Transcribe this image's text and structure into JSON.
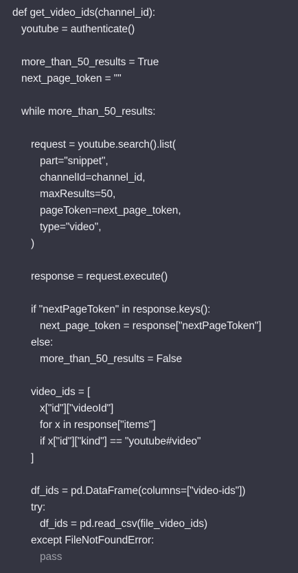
{
  "code": {
    "lines": [
      {
        "indent": 0,
        "text": "def get_video_ids(channel_id):"
      },
      {
        "indent": 1,
        "text": "youtube = authenticate()"
      },
      {
        "indent": 0,
        "text": ""
      },
      {
        "indent": 1,
        "text": "more_than_50_results = True"
      },
      {
        "indent": 1,
        "text": "next_page_token = \"\""
      },
      {
        "indent": 0,
        "text": ""
      },
      {
        "indent": 1,
        "text": "while more_than_50_results:"
      },
      {
        "indent": 0,
        "text": ""
      },
      {
        "indent": 2,
        "text": "request = youtube.search().list("
      },
      {
        "indent": 3,
        "text": "part=\"snippet\","
      },
      {
        "indent": 3,
        "text": "channelId=channel_id,"
      },
      {
        "indent": 3,
        "text": "maxResults=50,"
      },
      {
        "indent": 3,
        "text": "pageToken=next_page_token,"
      },
      {
        "indent": 3,
        "text": "type=\"video\","
      },
      {
        "indent": 2,
        "text": ")"
      },
      {
        "indent": 0,
        "text": ""
      },
      {
        "indent": 2,
        "text": "response = request.execute()"
      },
      {
        "indent": 0,
        "text": ""
      },
      {
        "indent": 2,
        "text": "if \"nextPageToken\" in response.keys():"
      },
      {
        "indent": 3,
        "text": "next_page_token = response[\"nextPageToken\"]"
      },
      {
        "indent": 2,
        "text": "else:"
      },
      {
        "indent": 3,
        "text": "more_than_50_results = False"
      },
      {
        "indent": 0,
        "text": ""
      },
      {
        "indent": 2,
        "text": "video_ids = ["
      },
      {
        "indent": 3,
        "text": "x[\"id\"][\"videoId\"]"
      },
      {
        "indent": 3,
        "text": "for x in response[\"items\"]"
      },
      {
        "indent": 3,
        "text": "if x[\"id\"][\"kind\"] == \"youtube#video\""
      },
      {
        "indent": 2,
        "text": "]"
      },
      {
        "indent": 0,
        "text": ""
      },
      {
        "indent": 2,
        "text": "df_ids = pd.DataFrame(columns=[\"video-ids\"])"
      },
      {
        "indent": 2,
        "text": "try:"
      },
      {
        "indent": 3,
        "text": "df_ids = pd.read_csv(file_video_ids)"
      },
      {
        "indent": 2,
        "text": "except FileNotFoundError:"
      },
      {
        "indent": 3,
        "text": "pass",
        "muted": true
      }
    ]
  },
  "colors": {
    "background": "#343541",
    "text": "#ececf1",
    "muted_text": "#9ea0a8"
  }
}
